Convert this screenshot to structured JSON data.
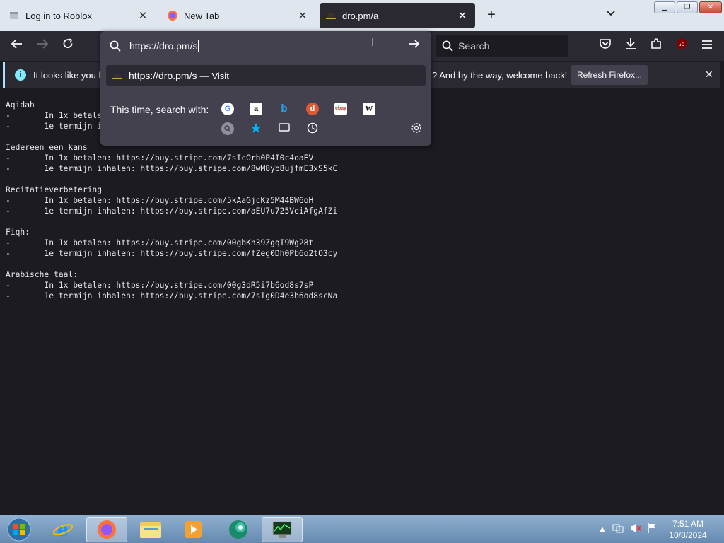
{
  "tabs": [
    {
      "title": "Log in to Roblox",
      "active": false
    },
    {
      "title": "New Tab",
      "active": false
    },
    {
      "title": "dro.pm/a",
      "active": true
    }
  ],
  "toolbar": {
    "new_tab_label": "+",
    "search_placeholder": "Search"
  },
  "urlbar": {
    "value": "https://dro.pm/s",
    "suggestion_url": "https://dro.pm/s",
    "suggestion_sep": "—",
    "suggestion_action": "Visit",
    "search_with_label": "This time, search with:",
    "engines": [
      "google",
      "amazon",
      "bing",
      "duckduckgo",
      "ebay",
      "wikipedia",
      "history-search",
      "bookmarks",
      "tabs",
      "history"
    ]
  },
  "infobar": {
    "message_start": "It looks like you ha",
    "message_end": "? And by the way, welcome back!",
    "refresh_label": "Refresh Firefox...",
    "info_icon": "i"
  },
  "content": {
    "text_lines": [
      "Aqidah",
      "-       In 1x betale",
      "-       1e termijn i",
      "",
      "Iedereen een kans",
      "-       In 1x betalen: https://buy.stripe.com/7sIcOrh0P4I0c4oaEV",
      "-       1e termijn inhalen: https://buy.stripe.com/8wM8yb8ujfmE3xS5kC",
      "",
      "Recitatieverbetering",
      "-       In 1x betalen: https://buy.stripe.com/5kAaGjcKz5M44BW6oH",
      "-       1e termijn inhalen: https://buy.stripe.com/aEU7u725VeiAfgAfZi",
      "",
      "Fiqh:",
      "-       In 1x betalen: https://buy.stripe.com/00gbKn39ZgqI9Wg28t",
      "-       1e termijn inhalen: https://buy.stripe.com/fZeg0Dh0Pb6o2tO3cy",
      "",
      "Arabische taal:",
      "-       In 1x betalen: https://buy.stripe.com/00g3dR5i7b6od8s7sP",
      "-       1e termijn inhalen: https://buy.stripe.com/7sIg0D4e3b6od8scNa"
    ]
  },
  "taskbar": {
    "time": "7:51 AM",
    "date": "10/8/2024"
  },
  "colors": {
    "background": "#1c1b22",
    "toolbar": "#2b2a33",
    "accent": "#80ebff"
  }
}
